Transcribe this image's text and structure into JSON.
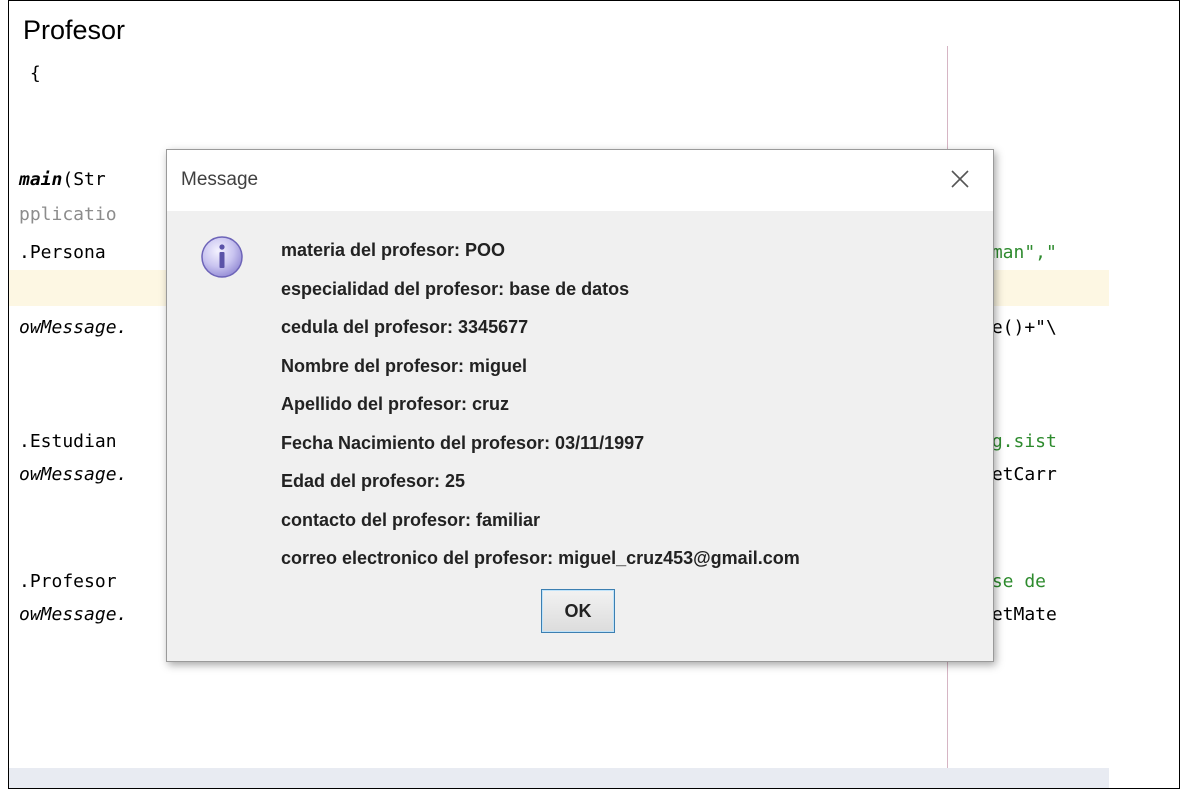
{
  "document": {
    "title": "Profesor"
  },
  "code": {
    "left_lines": [
      {
        "text": " {",
        "style": ""
      },
      {
        "text": "main",
        "style": "bold italic"
      },
      {
        "text": "(Str",
        "style": ""
      },
      {
        "text": "pplicatio",
        "style": "gray"
      },
      {
        "text": ".Persona",
        "style": ""
      },
      {
        "text": "owMessage.",
        "style": "italic"
      },
      {
        "text": ".Estudian",
        "style": ""
      },
      {
        "text": "owMessage.",
        "style": "italic"
      },
      {
        "text": ".Profesor",
        "style": ""
      },
      {
        "text": "owMessage.",
        "style": "italic"
      }
    ],
    "right_lines": [
      {
        "text": "zman\",\"",
        "style": "green"
      },
      {
        "text": "re()+\"\\",
        "style": ""
      },
      {
        "text": "ng.sist",
        "style": "green"
      },
      {
        "text": "getCarr",
        "style": ""
      },
      {
        "text": "ase de",
        "style": "green"
      },
      {
        "text": "getMate",
        "style": ""
      }
    ]
  },
  "dialog": {
    "title": "Message",
    "close_icon": "close-icon",
    "info_icon": "info-icon",
    "lines": [
      "materia del profesor: POO",
      "especialidad del profesor: base de datos",
      "cedula del profesor: 3345677",
      "Nombre del profesor: miguel",
      "Apellido del profesor: cruz",
      "Fecha Nacimiento del profesor: 03/11/1997",
      "Edad del profesor: 25",
      "contacto del profesor: familiar",
      "correo electronico del profesor: miguel_cruz453@gmail.com"
    ],
    "ok_label": "OK"
  },
  "colors": {
    "dialog_bg": "#f0f0f0",
    "highlight_row": "#fdf7e3",
    "string_green": "#2e8b2e",
    "ok_border": "#3c7fb1"
  }
}
